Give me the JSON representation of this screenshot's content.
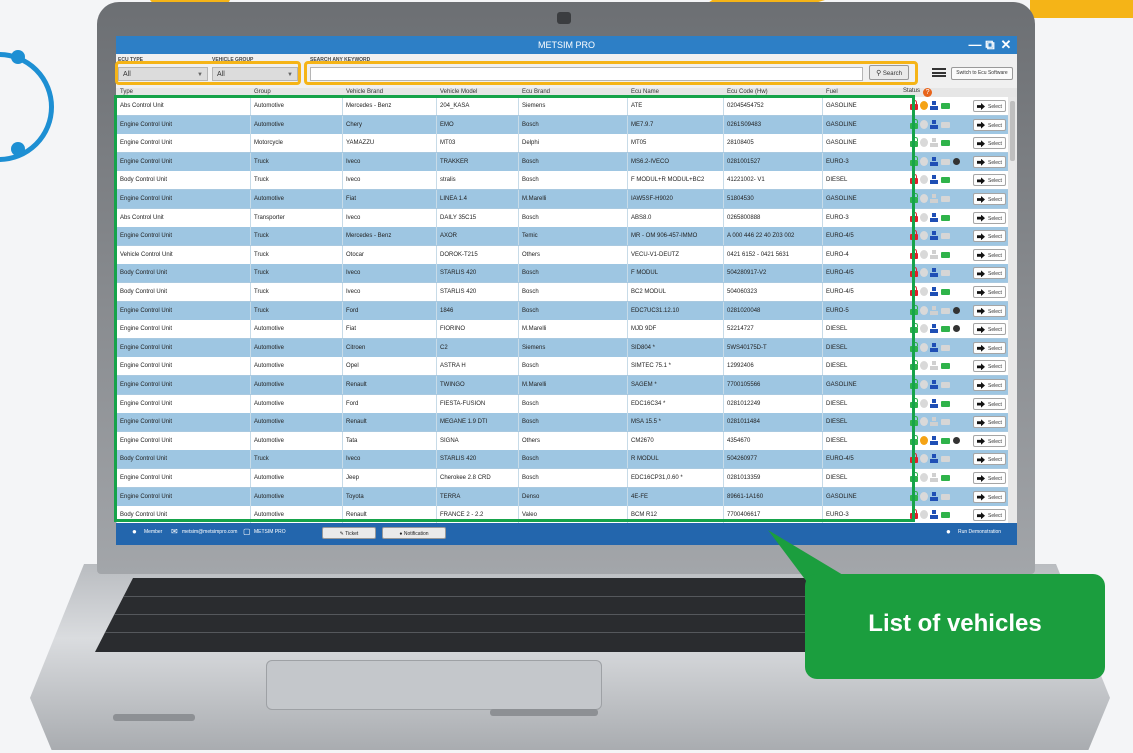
{
  "app": {
    "title": "METSIM PRO"
  },
  "filters": {
    "ecu_type_label": "ECU TYPE",
    "vehicle_group_label": "VEHICLE GROUP",
    "search_label": "SEARCH ANY KEYWORD",
    "ecu_type_value": "All",
    "vehicle_group_value": "All",
    "search_value": "",
    "search_button": "Search",
    "switch_button": "Switch to Ecu Software"
  },
  "table": {
    "columns": [
      "Type",
      "Group",
      "Vehicle Brand",
      "Vehicle Model",
      "Ecu Brand",
      "Ecu Name",
      "Ecu Code (Hw)",
      "Fuel",
      "Status"
    ],
    "select_label": "Select",
    "rows": [
      {
        "type": "Abs Control Unit",
        "group": "Automotive",
        "brand": "Mercedes - Benz",
        "model": "204_KASA",
        "ecu_brand": "Siemens",
        "ecu_name": "ATE",
        "ecu_code": "02045454752",
        "fuel": "GASOLINE"
      },
      {
        "type": "Engine Control Unit",
        "group": "Automotive",
        "brand": "Chery",
        "model": "EMO",
        "ecu_brand": "Bosch",
        "ecu_name": "ME7.9.7",
        "ecu_code": "0261S09483",
        "fuel": "GASOLINE"
      },
      {
        "type": "Engine Control Unit",
        "group": "Motorcycle",
        "brand": "YAMAZZU",
        "model": "MT03",
        "ecu_brand": "Delphi",
        "ecu_name": "MT05",
        "ecu_code": "28108405",
        "fuel": "GASOLINE"
      },
      {
        "type": "Engine Control Unit",
        "group": "Truck",
        "brand": "Iveco",
        "model": "TRAKKER",
        "ecu_brand": "Bosch",
        "ecu_name": "MS6.2-IVECO",
        "ecu_code": "0281001527",
        "fuel": "EURO-3"
      },
      {
        "type": "Body Control Unit",
        "group": "Truck",
        "brand": "Iveco",
        "model": "stralis",
        "ecu_brand": "Bosch",
        "ecu_name": "F MODUL+R MODUL+BC2",
        "ecu_code": "41221002- V1",
        "fuel": "DIESEL"
      },
      {
        "type": "Engine Control Unit",
        "group": "Automotive",
        "brand": "Fiat",
        "model": "LINEA 1.4",
        "ecu_brand": "M.Marelli",
        "ecu_name": "IAW5SF-H9020",
        "ecu_code": "51804530",
        "fuel": "GASOLINE"
      },
      {
        "type": "Abs Control Unit",
        "group": "Transporter",
        "brand": "Iveco",
        "model": "DAILY 35C15",
        "ecu_brand": "Bosch",
        "ecu_name": "ABS8.0",
        "ecu_code": "0265800888",
        "fuel": "EURO-3"
      },
      {
        "type": "Engine Control Unit",
        "group": "Truck",
        "brand": "Mercedes - Benz",
        "model": "AXOR",
        "ecu_brand": "Temic",
        "ecu_name": "MR - OM 906-457-IMMO",
        "ecu_code": "A 000 446 22 40 Z03 002",
        "fuel": "EURO-4/5"
      },
      {
        "type": "Vehicle Control Unit",
        "group": "Truck",
        "brand": "Otocar",
        "model": "DOROK-T215",
        "ecu_brand": "Others",
        "ecu_name": "VECU-V1-DEUTZ",
        "ecu_code": "0421 6152 - 0421 5631",
        "fuel": "EURO-4"
      },
      {
        "type": "Body Control Unit",
        "group": "Truck",
        "brand": "Iveco",
        "model": "STARLIS 420",
        "ecu_brand": "Bosch",
        "ecu_name": "F MODUL",
        "ecu_code": "504280917-V2",
        "fuel": "EURO-4/5"
      },
      {
        "type": "Body Control Unit",
        "group": "Truck",
        "brand": "Iveco",
        "model": "STARLIS 420",
        "ecu_brand": "Bosch",
        "ecu_name": "BC2 MODUL",
        "ecu_code": "504060323",
        "fuel": "EURO-4/5"
      },
      {
        "type": "Engine Control Unit",
        "group": "Truck",
        "brand": "Ford",
        "model": "1846",
        "ecu_brand": "Bosch",
        "ecu_name": "EDC7UC31.12.10",
        "ecu_code": "0281020048",
        "fuel": "EURO-5"
      },
      {
        "type": "Engine Control Unit",
        "group": "Automotive",
        "brand": "Fiat",
        "model": "FIORINO",
        "ecu_brand": "M.Marelli",
        "ecu_name": "MJD 9DF",
        "ecu_code": "52214727",
        "fuel": "DIESEL"
      },
      {
        "type": "Engine Control Unit",
        "group": "Automotive",
        "brand": "Citroen",
        "model": "C2",
        "ecu_brand": "Siemens",
        "ecu_name": "SID804 *",
        "ecu_code": "5WS40175D-T",
        "fuel": "DIESEL"
      },
      {
        "type": "Engine Control Unit",
        "group": "Automotive",
        "brand": "Opel",
        "model": "ASTRA H",
        "ecu_brand": "Bosch",
        "ecu_name": "SIMTEC 75.1 *",
        "ecu_code": "12992406",
        "fuel": "DIESEL"
      },
      {
        "type": "Engine Control Unit",
        "group": "Automotive",
        "brand": "Renault",
        "model": "TWINGO",
        "ecu_brand": "M.Marelli",
        "ecu_name": "SAGEM *",
        "ecu_code": "7700105566",
        "fuel": "GASOLINE"
      },
      {
        "type": "Engine Control Unit",
        "group": "Automotive",
        "brand": "Ford",
        "model": "FIESTA-FUSION",
        "ecu_brand": "Bosch",
        "ecu_name": "EDC16C34 *",
        "ecu_code": "0281012249",
        "fuel": "DIESEL"
      },
      {
        "type": "Engine Control Unit",
        "group": "Automotive",
        "brand": "Renault",
        "model": "MEGANE 1.9 DTI",
        "ecu_brand": "Bosch",
        "ecu_name": "MSA 15.5 *",
        "ecu_code": "0281011484",
        "fuel": "DIESEL"
      },
      {
        "type": "Engine Control Unit",
        "group": "Automotive",
        "brand": "Tata",
        "model": "SIGNA",
        "ecu_brand": "Others",
        "ecu_name": "CM2670",
        "ecu_code": "4354670",
        "fuel": "DIESEL"
      },
      {
        "type": "Body Control Unit",
        "group": "Truck",
        "brand": "Iveco",
        "model": "STARLIS 420",
        "ecu_brand": "Bosch",
        "ecu_name": "R MODUL",
        "ecu_code": "504260977",
        "fuel": "EURO-4/5"
      },
      {
        "type": "Engine Control Unit",
        "group": "Automotive",
        "brand": "Jeep",
        "model": "Cherokee 2.8 CRD",
        "ecu_brand": "Bosch",
        "ecu_name": "EDC16CP31,0.60 *",
        "ecu_code": "0281013359",
        "fuel": "DIESEL"
      },
      {
        "type": "Engine Control Unit",
        "group": "Automotive",
        "brand": "Toyota",
        "model": "TERRA",
        "ecu_brand": "Denso",
        "ecu_name": "4E-FE",
        "ecu_code": "89661-1A160",
        "fuel": "GASOLINE"
      },
      {
        "type": "Body Control Unit",
        "group": "Automotive",
        "brand": "Renault",
        "model": "FRANCE 2 - 2.2",
        "ecu_brand": "Valeo",
        "ecu_name": "BCM R12",
        "ecu_code": "7700406617",
        "fuel": "EURO-3"
      }
    ]
  },
  "statusbar": {
    "user": "Member",
    "email": "metsim@metsimpro.com",
    "device": "METSIM PRO",
    "ticket_button": "Ticket",
    "notification_button": "Notification",
    "right_text": "Run Demonstration"
  },
  "callout": {
    "text": "List of vehicles"
  },
  "colors": {
    "accent": "#2d7fc6",
    "row_alt": "#9ec6e2",
    "highlight_yellow": "#f5b417",
    "highlight_green": "#16a34a"
  }
}
